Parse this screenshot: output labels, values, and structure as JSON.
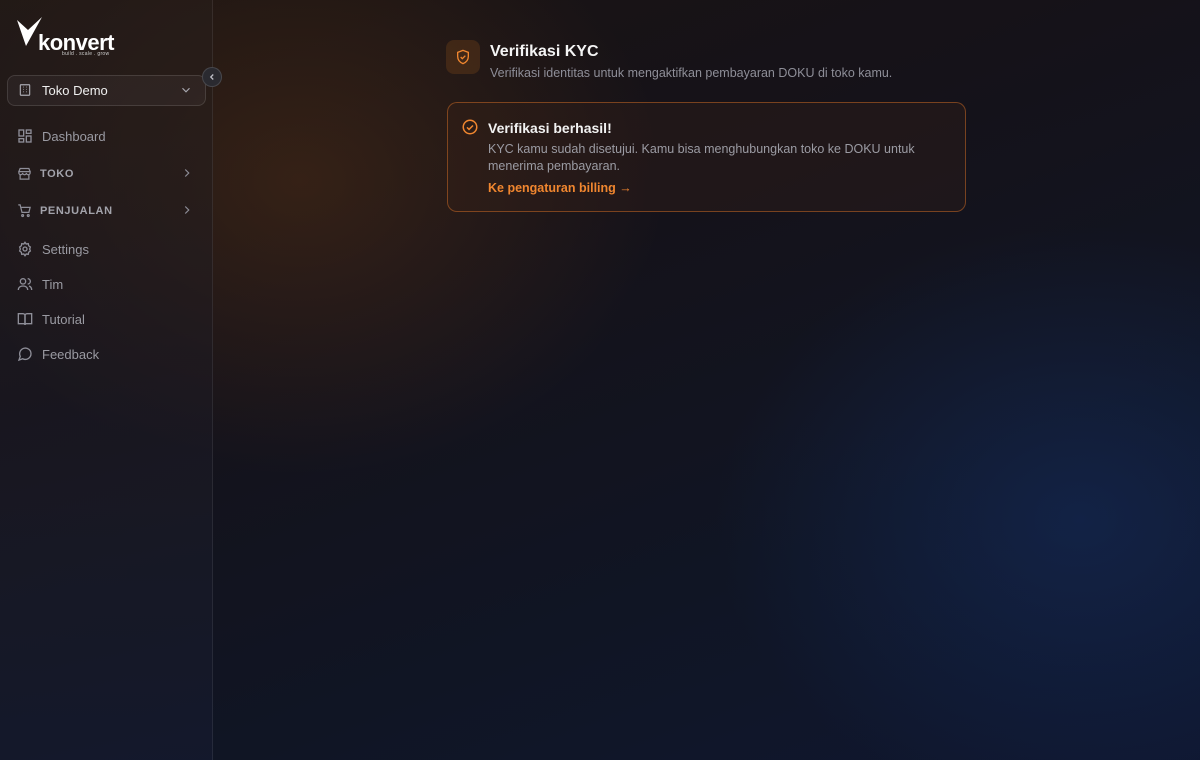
{
  "brand": {
    "name": "konvert",
    "tagline": "build . scale . grow"
  },
  "store_selector": {
    "value": "Toko Demo"
  },
  "sidebar": {
    "items": [
      {
        "label": "Dashboard",
        "icon": "dashboard-icon"
      },
      {
        "label": "TOKO",
        "icon": "store-icon",
        "expandable": true
      },
      {
        "label": "PENJUALAN",
        "icon": "cart-icon",
        "expandable": true
      },
      {
        "label": "Settings",
        "icon": "gear-icon"
      },
      {
        "label": "Tim",
        "icon": "users-icon"
      },
      {
        "label": "Tutorial",
        "icon": "book-icon"
      },
      {
        "label": "Feedback",
        "icon": "message-icon"
      }
    ]
  },
  "page": {
    "title": "Verifikasi KYC",
    "subtitle": "Verifikasi identitas untuk mengaktifkan pembayaran DOKU di toko kamu.",
    "icon": "shield-check-icon"
  },
  "status_card": {
    "title": "Verifikasi berhasil!",
    "body": "KYC kamu sudah disetujui. Kamu bisa menghubungkan toko ke DOKU untuk menerima pembayaran.",
    "link_label": "Ke pengaturan billing →",
    "icon": "check-circle-icon"
  },
  "colors": {
    "accent": "#f0862f",
    "card_border": "#e67828"
  }
}
